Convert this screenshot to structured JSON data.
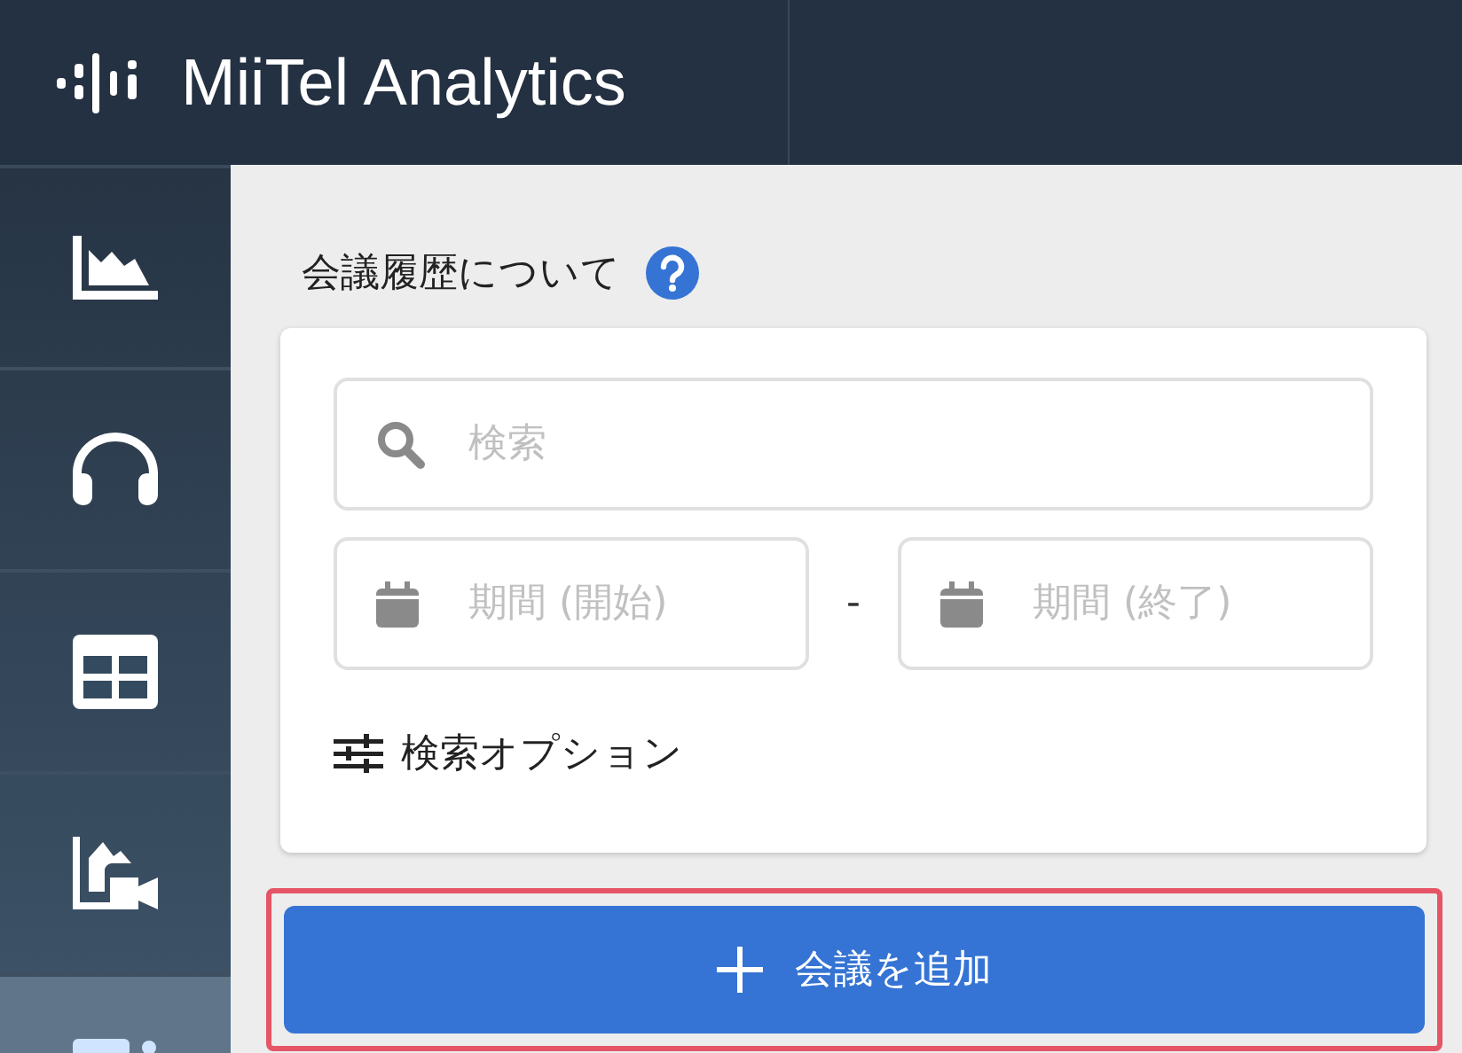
{
  "header": {
    "brand": "MiiTel Analytics"
  },
  "sidebar": {
    "items": [
      {
        "kind": "chart",
        "selected": false
      },
      {
        "kind": "headset",
        "selected": false
      },
      {
        "kind": "table",
        "selected": false
      },
      {
        "kind": "video-chart",
        "selected": false
      },
      {
        "kind": "partial",
        "selected": true
      }
    ]
  },
  "section": {
    "title": "会議履歴について"
  },
  "search": {
    "placeholder": "検索"
  },
  "period": {
    "start_placeholder": "期間 (開始)",
    "separator": "-",
    "end_placeholder": "期間 (終了)"
  },
  "options": {
    "label": "検索オプション"
  },
  "add_button": {
    "label": "会議を追加",
    "highlighted": true
  }
}
